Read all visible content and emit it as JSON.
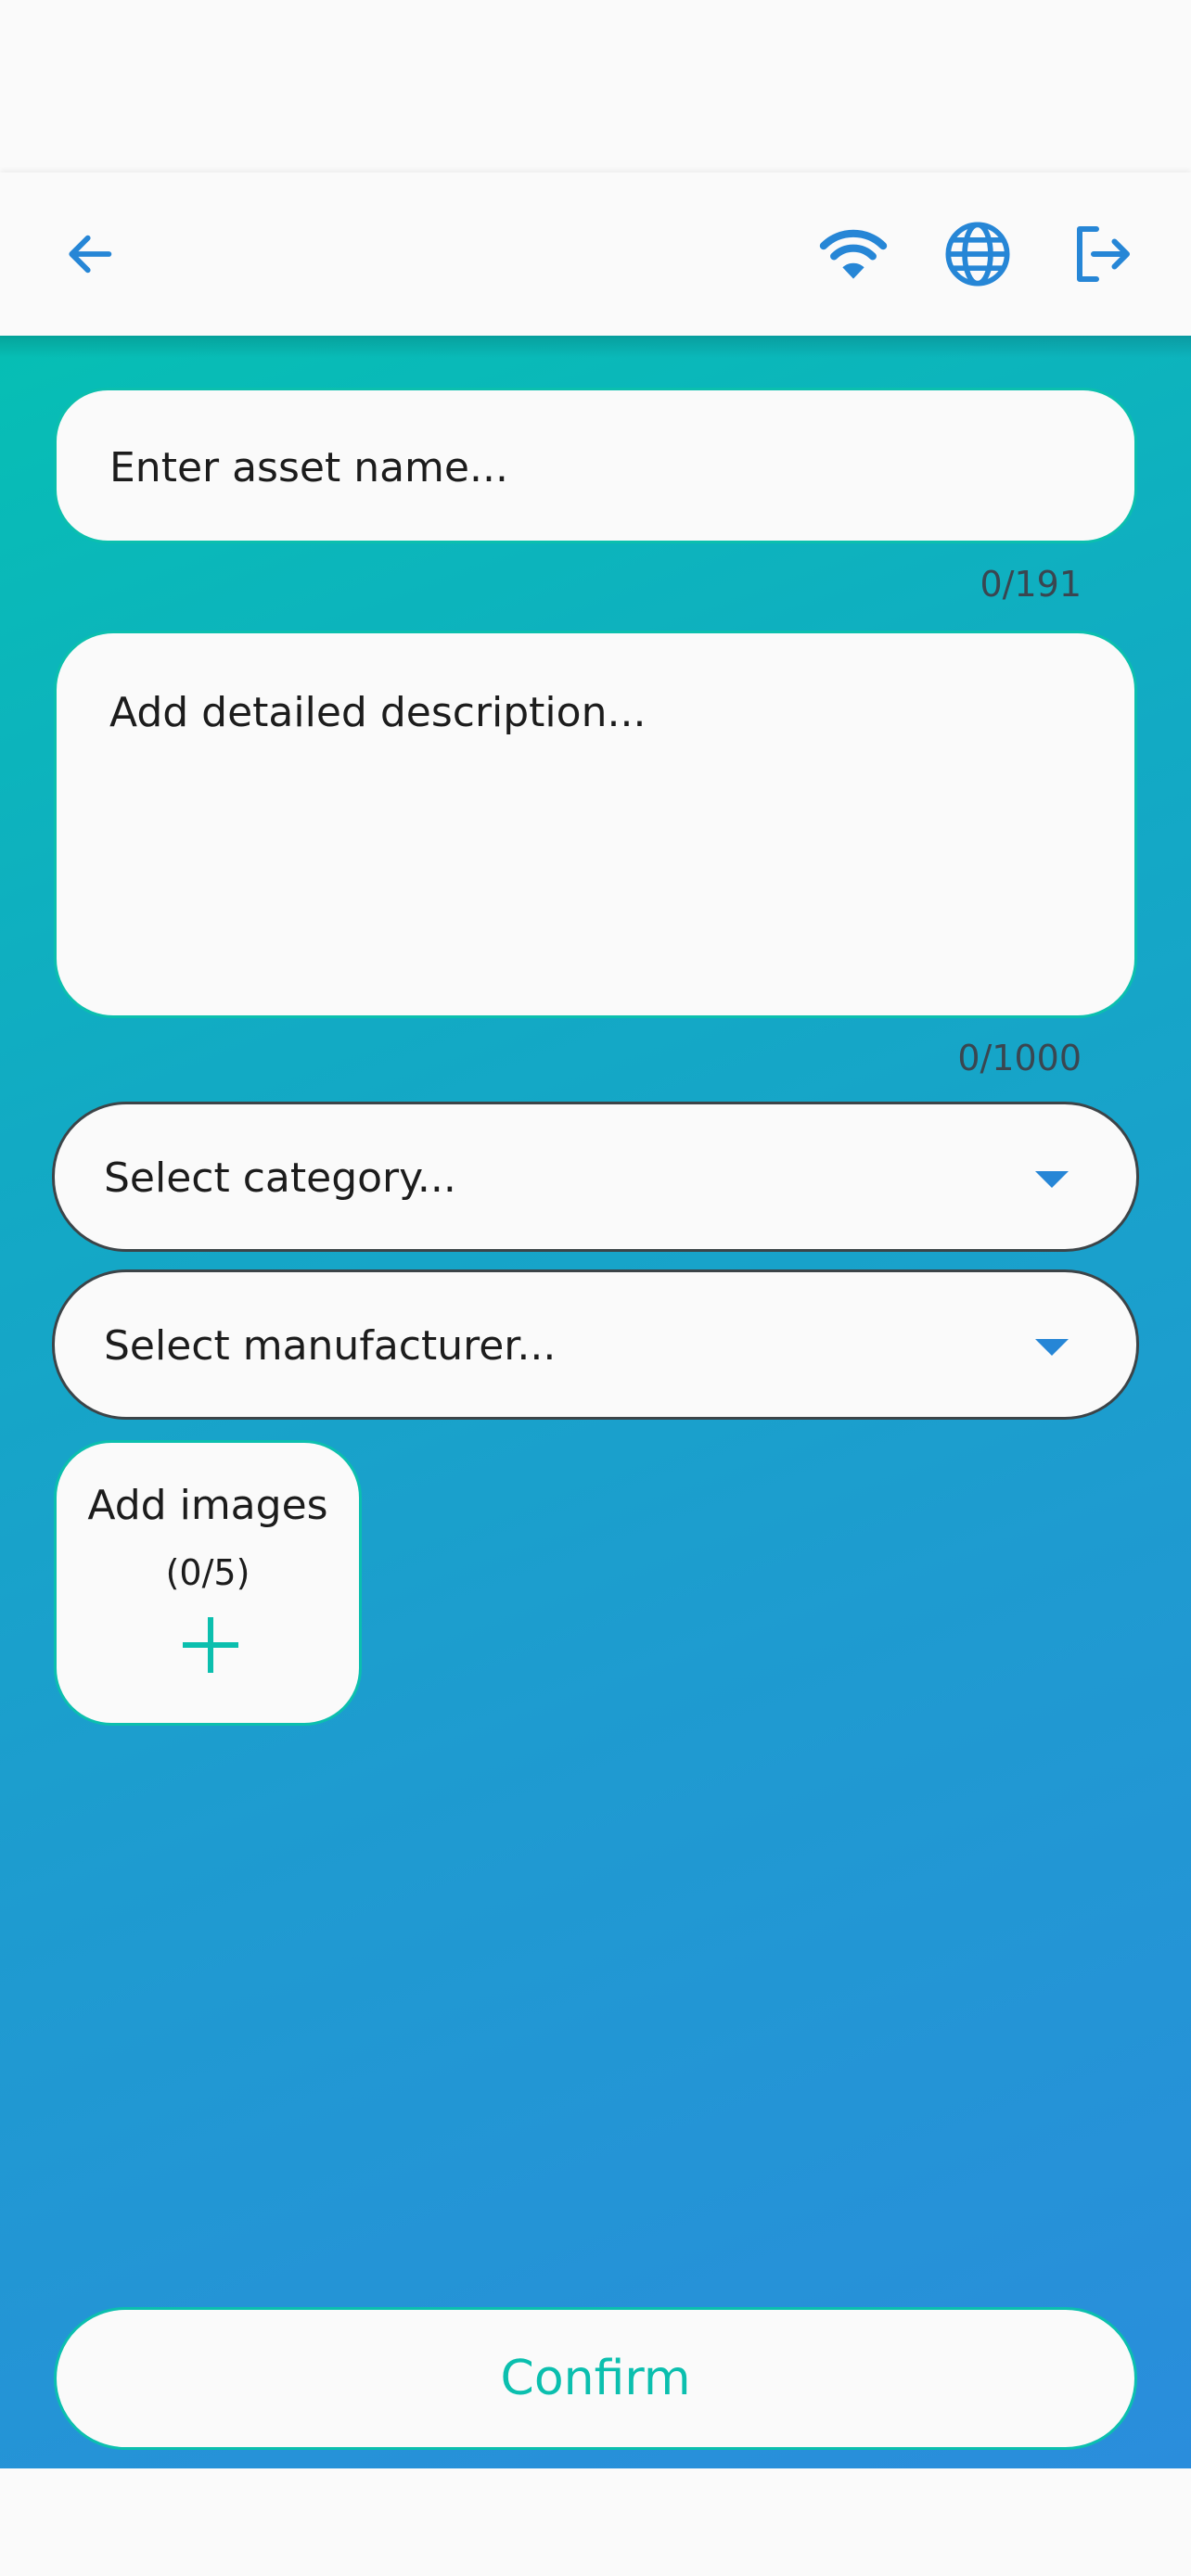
{
  "appbar": {
    "back_icon": "arrow-left-icon",
    "actions": [
      {
        "icon": "wifi-icon"
      },
      {
        "icon": "globe-icon"
      },
      {
        "icon": "logout-icon"
      }
    ]
  },
  "form": {
    "name": {
      "placeholder": "Enter asset name...",
      "counter": "0/191"
    },
    "description": {
      "placeholder": "Add detailed description...",
      "counter": "0/1000"
    },
    "category": {
      "placeholder": "Select category..."
    },
    "manufacturer": {
      "placeholder": "Select manufacturer..."
    },
    "images": {
      "label": "Add images",
      "count": "(0/5)",
      "icon": "plus-icon"
    },
    "confirm_label": "Confirm"
  },
  "colors": {
    "accent": "#0bbfae",
    "icon_blue": "#2686d6",
    "gradient_start": "#06bfb4",
    "gradient_end": "#2a8ddc",
    "surface": "#fafafa"
  }
}
